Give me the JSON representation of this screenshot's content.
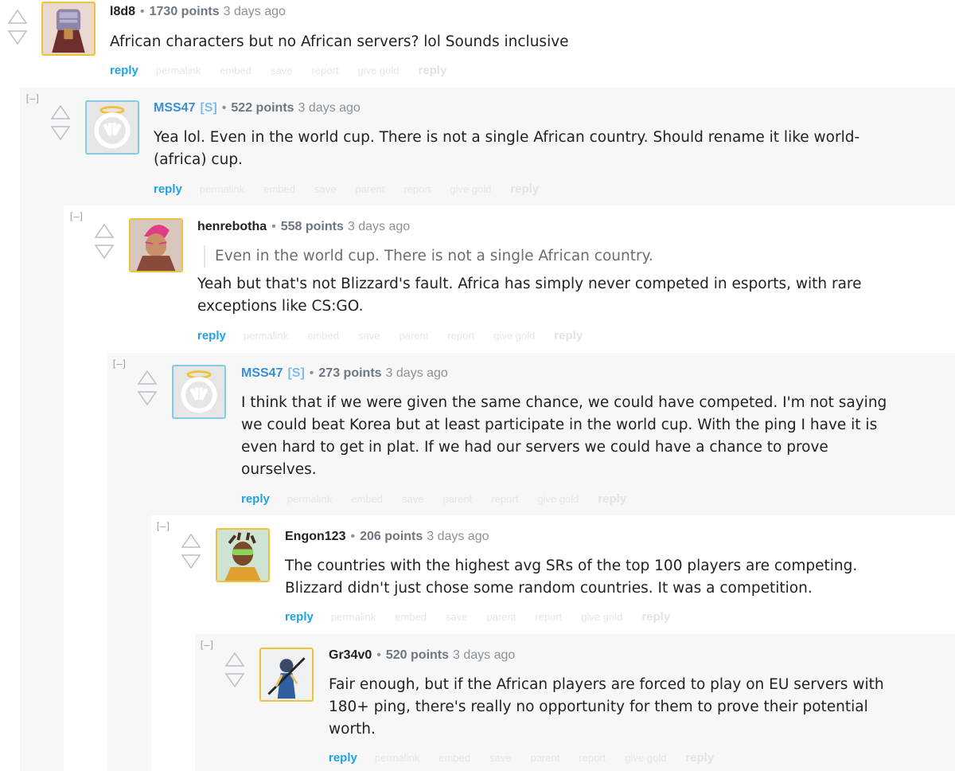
{
  "comments": [
    {
      "author": "l8d8",
      "op_tag": "",
      "points": "1730 points",
      "time": "3 days ago",
      "body": [
        "African characters but no African servers? lol Sounds inclusive"
      ],
      "quote": "",
      "actions": [
        "reply",
        "permalink",
        "embed",
        "save",
        "report",
        "give gold",
        "reply"
      ]
    },
    {
      "author": "MSS47",
      "op_tag": "[S]",
      "points": "522 points",
      "time": "3 days ago",
      "body": [
        "Yea lol. Even in the world cup. There is not a single African country. Should rename it like world-",
        "(africa) cup."
      ],
      "quote": "",
      "actions": [
        "reply",
        "permalink",
        "embed",
        "save",
        "parent",
        "report",
        "give gold",
        "reply"
      ]
    },
    {
      "author": "henrebotha",
      "op_tag": "",
      "points": "558 points",
      "time": "3 days ago",
      "body": [
        "Yeah but that's not Blizzard's fault. Africa has simply never competed in esports, with rare",
        "exceptions like CS:GO."
      ],
      "quote": "Even in the world cup. There is not a single African country.",
      "actions": [
        "reply",
        "permalink",
        "embed",
        "save",
        "parent",
        "report",
        "give gold",
        "reply"
      ]
    },
    {
      "author": "MSS47",
      "op_tag": "[S]",
      "points": "273 points",
      "time": "3 days ago",
      "body": [
        "I think that if we were given the same chance, we could have competed. I'm not saying",
        "we could beat Korea but at least participate in the world cup. With the ping I have it is",
        "even hard to get in plat. If we had our servers we could have a chance to prove",
        "ourselves."
      ],
      "quote": "",
      "actions": [
        "reply",
        "permalink",
        "embed",
        "save",
        "parent",
        "report",
        "give gold",
        "reply"
      ]
    },
    {
      "author": "Engon123",
      "op_tag": "",
      "points": "206 points",
      "time": "3 days ago",
      "body": [
        "The countries with the highest avg SRs of the top 100 players are competing.",
        "Blizzard didn't just chose some random countries. It was a competition."
      ],
      "quote": "",
      "actions": [
        "reply",
        "permalink",
        "embed",
        "save",
        "parent",
        "report",
        "give gold",
        "reply"
      ]
    },
    {
      "author": "Gr34v0",
      "op_tag": "",
      "points": "520 points",
      "time": "3 days ago",
      "body": [
        "Fair enough, but if the African players are forced to play on EU servers with",
        "180+ ping, there's really no opportunity for them to prove their potential",
        "worth."
      ],
      "quote": "",
      "actions": [
        "reply",
        "permalink",
        "embed",
        "save",
        "parent",
        "report",
        "give gold",
        "reply"
      ]
    }
  ],
  "collapse_label": "[–]",
  "separator": "•",
  "colors": {
    "accent": "#1fa3e6",
    "op": "#3b8fd6",
    "avatar_gold": "#f0c23a",
    "avatar_blue": "#7fcbe8"
  },
  "icons": [
    "upvote-arrow-icon",
    "downvote-arrow-icon"
  ]
}
